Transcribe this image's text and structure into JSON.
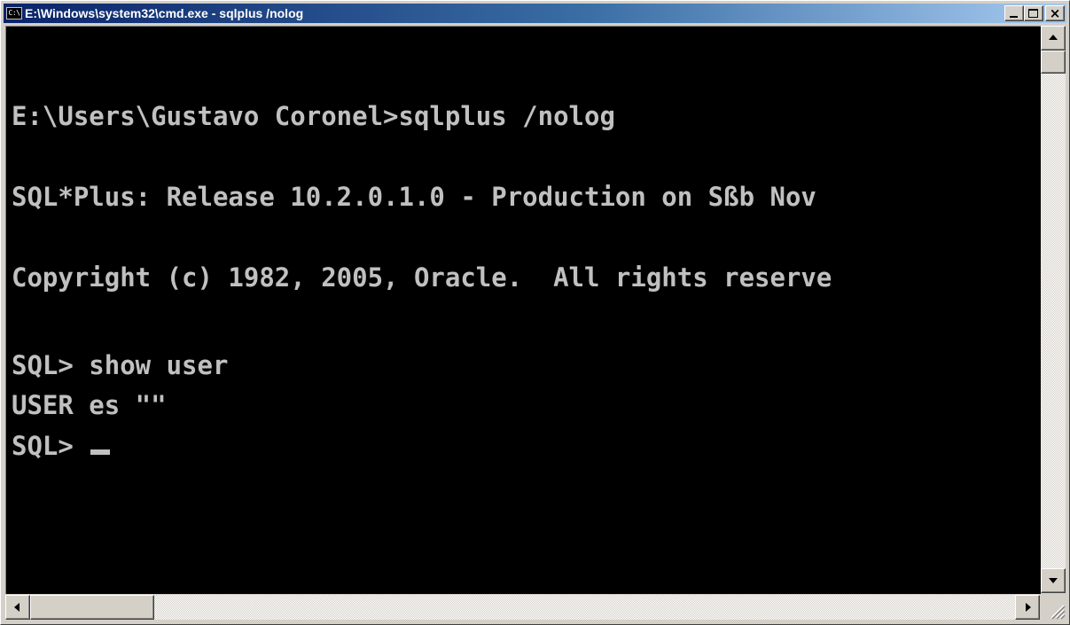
{
  "window": {
    "title": "E:\\Windows\\system32\\cmd.exe - sqlplus  /nolog",
    "icon": "cmd-icon",
    "icon_text": "C:\\",
    "buttons": [
      "minimize",
      "maximize",
      "close"
    ],
    "close_glyph": "×"
  },
  "console": {
    "background": "#000000",
    "text_color": "#c0c0c0",
    "lines": {
      "l1": "E:\\Users\\Gustavo Coronel>sqlplus /nolog",
      "l2": "SQL*Plus: Release 10.2.0.1.0 - Production on Sßb Nov",
      "l3": "Copyright (c) 1982, 2005, Oracle.  All rights reserve",
      "l4": "SQL> show user",
      "l5": "USER es \"\"",
      "l6": "SQL> "
    }
  },
  "colors": {
    "titlebar_start": "#0a246a",
    "titlebar_end": "#a6caf0",
    "chrome": "#d4d0c8"
  }
}
